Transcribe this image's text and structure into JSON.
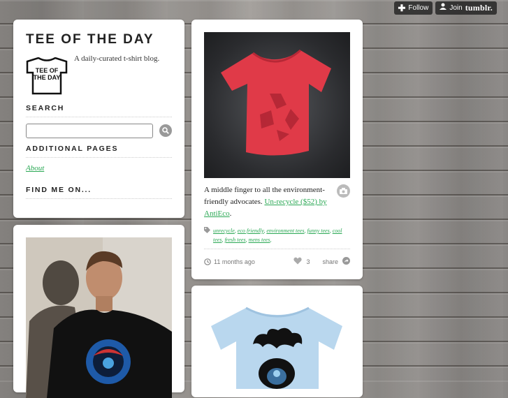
{
  "tumblr_controls": {
    "follow_label": "Follow",
    "join_label": "Join",
    "join_brand": "tumblr."
  },
  "sidebar": {
    "title": "TEE OF THE DAY",
    "logo_text": [
      "TEE OF",
      "THE DAY"
    ],
    "tagline": "A daily-curated t-shirt blog.",
    "search_heading": "SEARCH",
    "search_placeholder": "",
    "additional_pages_heading": "ADDITIONAL PAGES",
    "about_link": "About",
    "find_me_heading": "FIND ME ON..."
  },
  "post": {
    "caption_text": "A middle finger to all the environment-friendly advocates.",
    "caption_link": "Un-recycle ($52) by AntiEco",
    "caption_end": ".",
    "tags": [
      "unrecycle",
      "eco friendly",
      "environment tees",
      "funny tees",
      "cool tees",
      "fresh tees",
      "mens tees"
    ],
    "time": "11 months ago",
    "notes_count": "3",
    "share_label": "share"
  },
  "colors": {
    "accent_link": "#2aa854",
    "shirt_red": "#e03a48"
  }
}
